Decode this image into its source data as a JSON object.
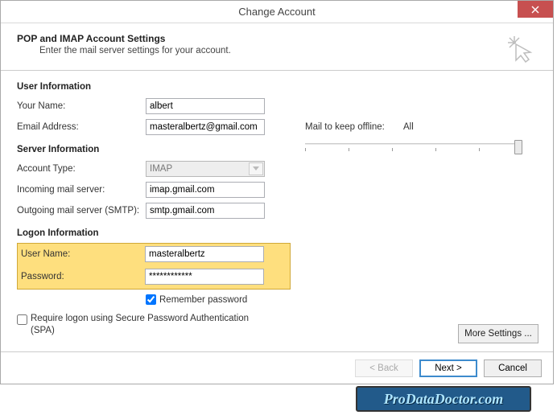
{
  "window_title": "Change Account",
  "header": {
    "title": "POP and IMAP Account Settings",
    "subtitle": "Enter the mail server settings for your account."
  },
  "sections": {
    "user_info": "User Information",
    "server_info": "Server Information",
    "logon_info": "Logon Information"
  },
  "labels": {
    "your_name": "Your Name:",
    "email": "Email Address:",
    "account_type": "Account Type:",
    "incoming": "Incoming mail server:",
    "outgoing": "Outgoing mail server (SMTP):",
    "username": "User Name:",
    "password": "Password:",
    "remember": "Remember password",
    "require_spa": "Require logon using Secure Password Authentication (SPA)",
    "mail_keep": "Mail to keep offline:"
  },
  "values": {
    "your_name": "albert",
    "email": "masteralbertz@gmail.com",
    "account_type": "IMAP",
    "incoming": "imap.gmail.com",
    "outgoing": "smtp.gmail.com",
    "username": "masteralbertz",
    "password": "************",
    "remember_checked": true,
    "spa_checked": false,
    "mail_keep": "All"
  },
  "buttons": {
    "more_settings": "More Settings ...",
    "back": "< Back",
    "next": "Next >",
    "cancel": "Cancel"
  },
  "watermark": "ProDataDoctor.com"
}
